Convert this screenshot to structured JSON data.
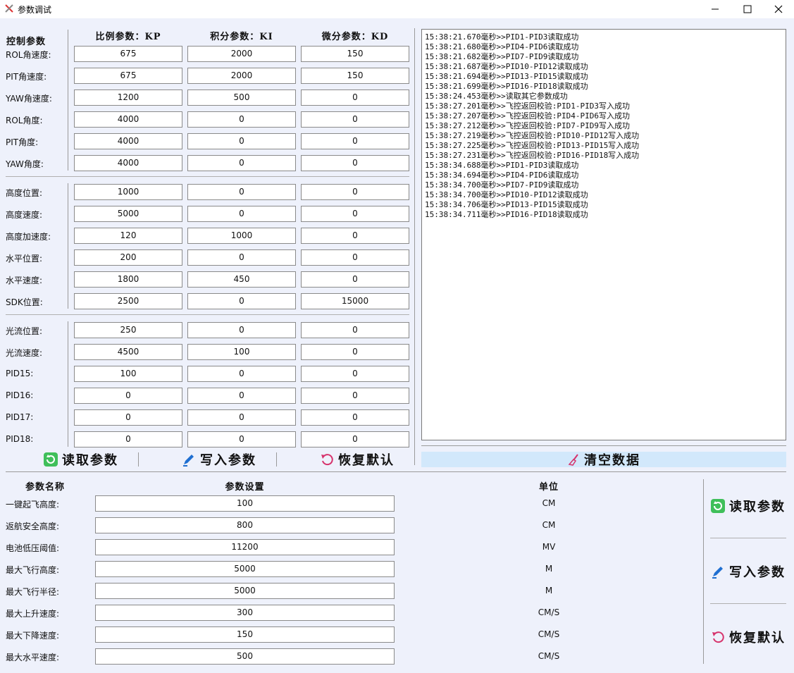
{
  "window": {
    "title": "参数调试",
    "icon": "tools-icon"
  },
  "pid": {
    "section_label": "控制参数",
    "col_headers": [
      "比例参数：KP",
      "积分参数：KI",
      "微分参数：KD"
    ],
    "rows": [
      {
        "label": "ROL角速度:",
        "kp": "675",
        "ki": "2000",
        "kd": "150"
      },
      {
        "label": "PIT角速度:",
        "kp": "675",
        "ki": "2000",
        "kd": "150"
      },
      {
        "label": "YAW角速度:",
        "kp": "1200",
        "ki": "500",
        "kd": "0"
      },
      {
        "label": "ROL角度:",
        "kp": "4000",
        "ki": "0",
        "kd": "0"
      },
      {
        "label": "PIT角度:",
        "kp": "4000",
        "ki": "0",
        "kd": "0"
      },
      {
        "label": "YAW角度:",
        "kp": "4000",
        "ki": "0",
        "kd": "0"
      },
      {
        "label": "高度位置:",
        "kp": "1000",
        "ki": "0",
        "kd": "0"
      },
      {
        "label": "高度速度:",
        "kp": "5000",
        "ki": "0",
        "kd": "0"
      },
      {
        "label": "高度加速度:",
        "kp": "120",
        "ki": "1000",
        "kd": "0"
      },
      {
        "label": "水平位置:",
        "kp": "200",
        "ki": "0",
        "kd": "0"
      },
      {
        "label": "水平速度:",
        "kp": "1800",
        "ki": "450",
        "kd": "0"
      },
      {
        "label": "SDK位置:",
        "kp": "2500",
        "ki": "0",
        "kd": "15000"
      },
      {
        "label": "光流位置:",
        "kp": "250",
        "ki": "0",
        "kd": "0"
      },
      {
        "label": "光流速度:",
        "kp": "4500",
        "ki": "100",
        "kd": "0"
      },
      {
        "label": "PID15:",
        "kp": "100",
        "ki": "0",
        "kd": "0"
      },
      {
        "label": "PID16:",
        "kp": "0",
        "ki": "0",
        "kd": "0"
      },
      {
        "label": "PID17:",
        "kp": "0",
        "ki": "0",
        "kd": "0"
      },
      {
        "label": "PID18:",
        "kp": "0",
        "ki": "0",
        "kd": "0"
      }
    ],
    "buttons": {
      "read": "读取参数",
      "write": "写入参数",
      "reset": "恢复默认"
    }
  },
  "log": {
    "lines": [
      "15:38:21.670毫秒>>PID1-PID3读取成功",
      "15:38:21.680毫秒>>PID4-PID6读取成功",
      "15:38:21.682毫秒>>PID7-PID9读取成功",
      "15:38:21.687毫秒>>PID10-PID12读取成功",
      "15:38:21.694毫秒>>PID13-PID15读取成功",
      "15:38:21.699毫秒>>PID16-PID18读取成功",
      "15:38:24.453毫秒>>读取其它参数成功",
      "15:38:27.201毫秒>>飞控返回校验:PID1-PID3写入成功",
      "15:38:27.207毫秒>>飞控返回校验:PID4-PID6写入成功",
      "15:38:27.212毫秒>>飞控返回校验:PID7-PID9写入成功",
      "15:38:27.219毫秒>>飞控返回校验:PID10-PID12写入成功",
      "15:38:27.225毫秒>>飞控返回校验:PID13-PID15写入成功",
      "15:38:27.231毫秒>>飞控返回校验:PID16-PID18写入成功",
      "15:38:34.688毫秒>>PID1-PID3读取成功",
      "15:38:34.694毫秒>>PID4-PID6读取成功",
      "15:38:34.700毫秒>>PID7-PID9读取成功",
      "15:38:34.700毫秒>>PID10-PID12读取成功",
      "15:38:34.706毫秒>>PID13-PID15读取成功",
      "15:38:34.711毫秒>>PID16-PID18读取成功"
    ],
    "clear_label": "清空数据"
  },
  "settings": {
    "headers": {
      "name": "参数名称",
      "value": "参数设置",
      "unit": "单位"
    },
    "rows": [
      {
        "label": "一键起飞高度:",
        "value": "100",
        "unit": "CM"
      },
      {
        "label": "返航安全高度:",
        "value": "800",
        "unit": "CM"
      },
      {
        "label": "电池低压阈值:",
        "value": "11200",
        "unit": "MV"
      },
      {
        "label": "最大飞行高度:",
        "value": "5000",
        "unit": "M"
      },
      {
        "label": "最大飞行半径:",
        "value": "5000",
        "unit": "M"
      },
      {
        "label": "最大上升速度:",
        "value": "300",
        "unit": "CM/S"
      },
      {
        "label": "最大下降速度:",
        "value": "150",
        "unit": "CM/S"
      },
      {
        "label": "最大水平速度:",
        "value": "500",
        "unit": "CM/S"
      }
    ],
    "buttons": {
      "read": "读取参数",
      "write": "写入参数",
      "reset": "恢复默认"
    }
  },
  "colors": {
    "background": "#eef1fb",
    "clear_button_bg": "#d2e8fb",
    "read_icon": "#3fbf5a",
    "write_icon": "#1f6fd1",
    "reset_icon": "#d6336c"
  }
}
